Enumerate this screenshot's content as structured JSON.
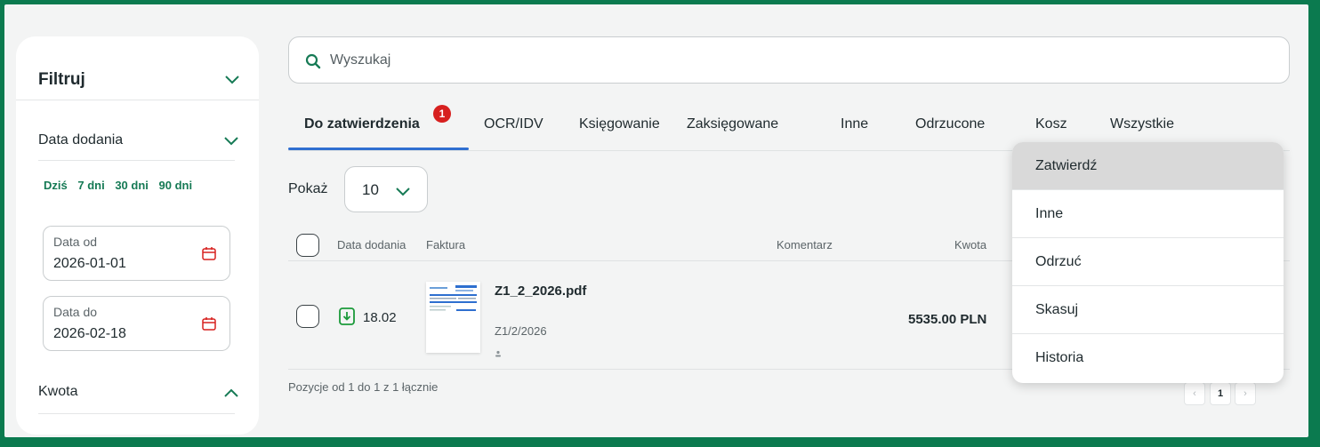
{
  "sidebar": {
    "title": "Filtruj",
    "date_section": {
      "label": "Data dodania",
      "quick": [
        "Dziś",
        "7 dni",
        "30 dni",
        "90 dni"
      ],
      "from": {
        "label": "Data od",
        "value": "2026-01-01"
      },
      "to": {
        "label": "Data do",
        "value": "2026-02-18"
      }
    },
    "amount_section": {
      "label": "Kwota"
    }
  },
  "search": {
    "placeholder": "Wyszukaj"
  },
  "tabs": [
    {
      "label": "Do zatwierdzenia",
      "badge": "1",
      "active": true
    },
    {
      "label": "OCR/IDV"
    },
    {
      "label": "Księgowanie"
    },
    {
      "label": "Zaksięgowane"
    },
    {
      "label": "Inne"
    },
    {
      "label": "Odrzucone"
    },
    {
      "label": "Kosz"
    },
    {
      "label": "Wszystkie"
    }
  ],
  "show": {
    "label": "Pokaż",
    "value": "10"
  },
  "table": {
    "headers": {
      "date": "Data dodania",
      "invoice": "Faktura",
      "comment": "Komentarz",
      "amount": "Kwota"
    },
    "rows": [
      {
        "date": "18.02",
        "file": "Z1_2_2026.pdf",
        "number": "Z1/2/2026",
        "amount": "5535.00 PLN"
      }
    ],
    "footer": "Pozycje od 1 do 1 z 1 łącznie"
  },
  "pager": {
    "prev": "‹",
    "current": "1",
    "next": "›"
  },
  "menu": {
    "items": [
      "Zatwierdź",
      "Inne",
      "Odrzuć",
      "Skasuj",
      "Historia"
    ]
  },
  "colors": {
    "accent_green": "#167a55",
    "tab_blue": "#2f6fd1",
    "badge_red": "#d7201f",
    "frame_green": "#0b7a4f"
  }
}
